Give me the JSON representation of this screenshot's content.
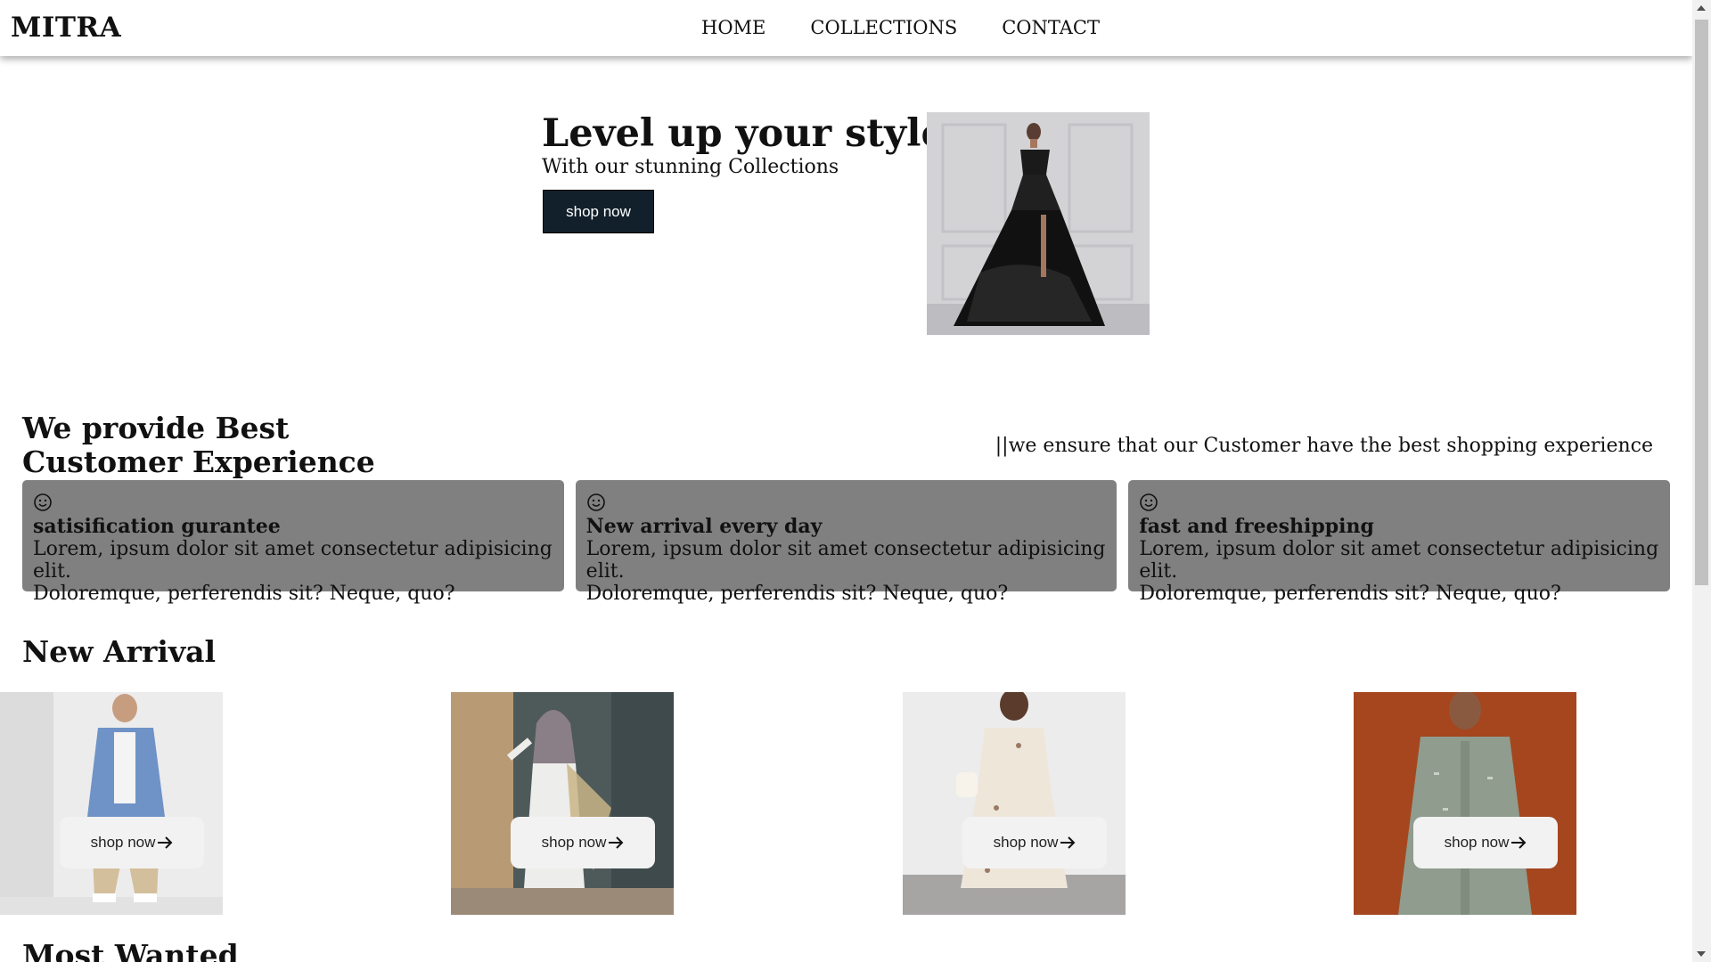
{
  "header": {
    "logo": "MITRA",
    "nav": [
      "HOME",
      "COLLECTIONS",
      "CONTACT"
    ]
  },
  "hero": {
    "title": "Level up your style",
    "subtitle": "With our stunning Collections",
    "button": "shop now",
    "image_icon": "black-gown-photo"
  },
  "experience": {
    "title_line1": "We provide Best",
    "title_line2": "Customer Experience",
    "tagline": "||we ensure that our Customer have the best shopping experience",
    "cards": [
      {
        "icon": "smiley-icon",
        "title": "satisification gurantee",
        "text_line1": "Lorem, ipsum dolor sit amet consectetur adipisicing elit.",
        "text_line2": "Doloremque, perferendis sit? Neque, quo?"
      },
      {
        "icon": "smiley-icon",
        "title": "New arrival every day",
        "text_line1": "Lorem, ipsum dolor sit amet consectetur adipisicing elit.",
        "text_line2": "Doloremque, perferendis sit? Neque, quo?"
      },
      {
        "icon": "smiley-icon",
        "title": "fast and freeshipping",
        "text_line1": "Lorem, ipsum dolor sit amet consectetur adipisicing elit.",
        "text_line2": "Doloremque, perferendis sit? Neque, quo?"
      }
    ]
  },
  "new_arrival": {
    "title": "New Arrival",
    "products": [
      {
        "image": "denim-shirt-man-photo",
        "button": "shop now"
      },
      {
        "image": "hijab-woman-photo",
        "button": "shop now"
      },
      {
        "image": "floral-dress-photo",
        "button": "shop now"
      },
      {
        "image": "green-kurta-man-photo",
        "button": "shop now"
      }
    ]
  },
  "most_wanted": {
    "title": "Most Wanted"
  },
  "colors": {
    "hero_button": "#12202b",
    "card_bg": "#808080",
    "shop_button_bg": "#f2f2f2"
  }
}
